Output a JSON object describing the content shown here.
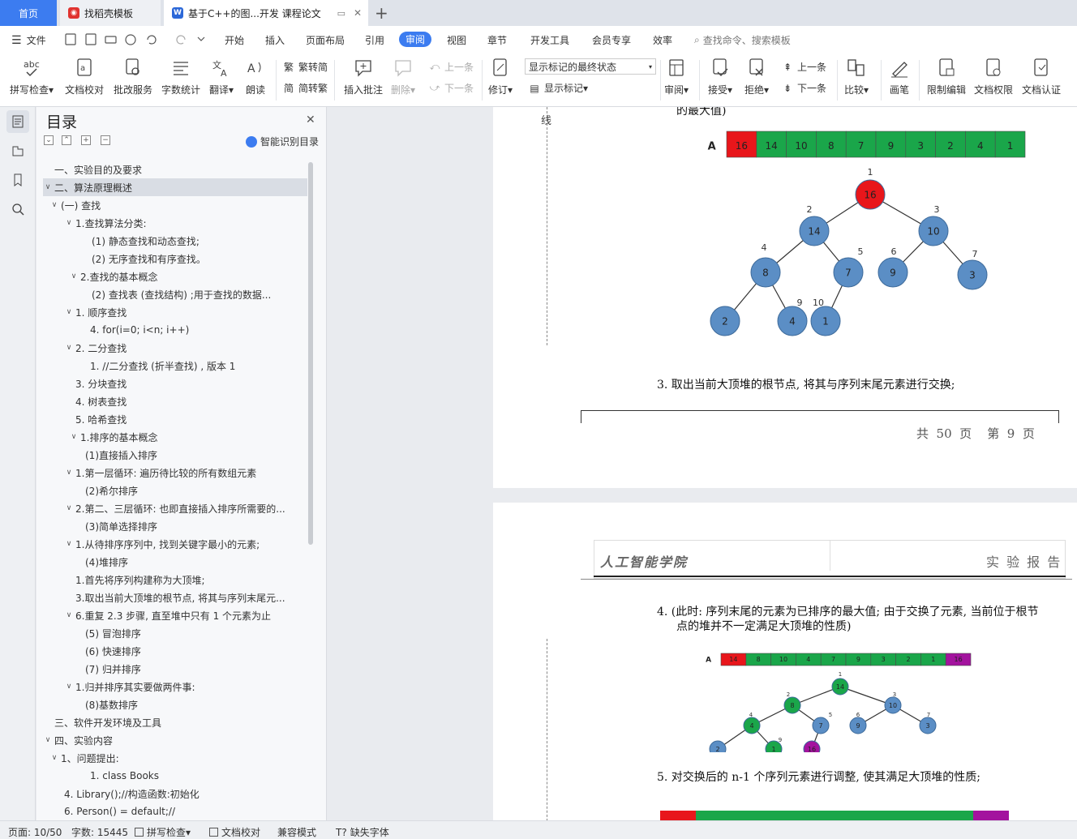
{
  "tabs": {
    "home": "首页",
    "template": "找稻壳模板",
    "doc": "基于C++的图...开发 课程论文"
  },
  "menu": {
    "file": "文件",
    "items": [
      "开始",
      "插入",
      "页面布局",
      "引用",
      "审阅",
      "视图",
      "章节",
      "开发工具",
      "会员专享",
      "效率"
    ],
    "active": "审阅",
    "search_placeholder": "查找命令、搜索模板"
  },
  "ribbon": {
    "spell": "拼写检查",
    "doc_check": "文档校对",
    "review_service": "批改服务",
    "word_count": "字数统计",
    "translate": "翻译",
    "read": "朗读",
    "to_traditional": "繁转简",
    "to_simplified": "简转繁",
    "insert_comment": "插入批注",
    "delete": "删除",
    "prev": "上一条",
    "next": "下一条",
    "track": "修订",
    "markup_state": "显示标记的最终状态",
    "show_markup": "显示标记",
    "review": "审阅",
    "accept": "接受",
    "reject": "拒绝",
    "prev2": "上一条",
    "next2": "下一条",
    "compare": "比较",
    "pen": "画笔",
    "restrict_edit": "限制编辑",
    "doc_permission": "文档权限",
    "doc_cert": "文档认证"
  },
  "toc": {
    "title": "目录",
    "smart": "智能识别目录",
    "items": [
      {
        "text": "一、实验目的及要求",
        "level": 1,
        "arrow": ""
      },
      {
        "text": "二、算法原理概述",
        "level": 1,
        "arrow": "down",
        "selected": true
      },
      {
        "text": "(一) 查找",
        "level": 2,
        "arrow": "down"
      },
      {
        "text": "1.查找算法分类:",
        "level": 3,
        "arrow": "down"
      },
      {
        "text": "(1) 静态查找和动态查找;",
        "level": 4,
        "arrow": ""
      },
      {
        "text": "(2) 无序查找和有序查找。",
        "level": 4,
        "arrow": ""
      },
      {
        "text": "2.查找的基本概念",
        "level": 3,
        "arrow": "down",
        "indent_extra": true
      },
      {
        "text": "(2) 查找表 (查找结构) ;用于查找的数据...",
        "level": 4,
        "arrow": ""
      },
      {
        "text": "1. 顺序查找",
        "level": 3,
        "arrow": "down"
      },
      {
        "text": "4.        for(i=0; i<n; i++)",
        "level": 4,
        "arrow": "",
        "tight": true
      },
      {
        "text": "2. 二分查找",
        "level": 3,
        "arrow": "down"
      },
      {
        "text": "1.    //二分查找 (折半查找) , 版本 1",
        "level": 4,
        "arrow": "",
        "tight": true
      },
      {
        "text": "3. 分块查找",
        "level": 3,
        "arrow": ""
      },
      {
        "text": "4. 树表查找",
        "level": 3,
        "arrow": ""
      },
      {
        "text": "5. 哈希查找",
        "level": 3,
        "arrow": ""
      },
      {
        "text": "1.排序的基本概念",
        "level": 3,
        "arrow": "down",
        "indent_extra": true
      },
      {
        "text": "(1)直接插入排序",
        "level": 4,
        "arrow": "",
        "mid": true
      },
      {
        "text": "1.第一层循环: 遍历待比较的所有数组元素",
        "level": 3,
        "arrow": "down"
      },
      {
        "text": "(2)希尔排序",
        "level": 4,
        "arrow": "",
        "mid": true
      },
      {
        "text": "2.第二、三层循环: 也即直接插入排序所需要的...",
        "level": 3,
        "arrow": "down"
      },
      {
        "text": "(3)简单选择排序",
        "level": 4,
        "arrow": "",
        "mid": true
      },
      {
        "text": "1.从待排序序列中, 找到关键字最小的元素;",
        "level": 3,
        "arrow": "down"
      },
      {
        "text": "(4)堆排序",
        "level": 4,
        "arrow": "",
        "mid": true
      },
      {
        "text": "1.首先将序列构建称为大顶堆;",
        "level": 3,
        "arrow": ""
      },
      {
        "text": "3.取出当前大顶堆的根节点, 将其与序列末尾元...",
        "level": 3,
        "arrow": ""
      },
      {
        "text": "6.重复 2.3 步骤, 直至堆中只有 1 个元素为止",
        "level": 3,
        "arrow": "down"
      },
      {
        "text": "(5) 冒泡排序",
        "level": 4,
        "arrow": "",
        "mid": true
      },
      {
        "text": "(6) 快速排序",
        "level": 4,
        "arrow": "",
        "mid": true
      },
      {
        "text": "(7) 归并排序",
        "level": 4,
        "arrow": "",
        "mid": true
      },
      {
        "text": "1.归并排序其实要做两件事:",
        "level": 3,
        "arrow": "down"
      },
      {
        "text": "(8)基数排序",
        "level": 4,
        "arrow": "",
        "mid": true
      },
      {
        "text": "三、软件开发环境及工具",
        "level": 1,
        "arrow": ""
      },
      {
        "text": "四、实验内容",
        "level": 1,
        "arrow": "down"
      },
      {
        "text": "1、问题提出:",
        "level": 2,
        "arrow": "down"
      },
      {
        "text": "1.     class Books",
        "level": 4,
        "arrow": "",
        "tight": true
      },
      {
        "text": "4.     Library();//构造函数:初始化",
        "level": 3,
        "arrow": "",
        "code": true
      },
      {
        "text": "6.     Person() = default;//",
        "level": 3,
        "arrow": "",
        "code": true
      }
    ]
  },
  "page1": {
    "top_text": "的最大值)",
    "margin_char": "线",
    "array_label": "A",
    "array": [
      "16",
      "14",
      "10",
      "8",
      "7",
      "9",
      "3",
      "2",
      "4",
      "1"
    ],
    "tree_nodes": [
      {
        "v": "16",
        "idx": "1",
        "color": "red"
      },
      {
        "v": "14",
        "idx": "2"
      },
      {
        "v": "10",
        "idx": "3"
      },
      {
        "v": "8",
        "idx": "4"
      },
      {
        "v": "7",
        "idx": "5"
      },
      {
        "v": "9",
        "idx": "6"
      },
      {
        "v": "3",
        "idx": "7"
      },
      {
        "v": "2",
        "idx": ""
      },
      {
        "v": "4",
        "idx": "9"
      },
      {
        "v": "1",
        "idx": "10"
      }
    ],
    "step3": "3.   取出当前大顶堆的根节点, 将其与序列末尾元素进行交换;",
    "footer": "共  50  页    第  9  页"
  },
  "page2": {
    "header_left": "人工智能学院",
    "header_right": "实 验 报 告",
    "step4_line1": "4.   (此时: 序列末尾的元素为已排序的最大值; 由于交换了元素, 当前位于根节",
    "step4_line2": "点的堆并不一定满足大顶堆的性质)",
    "array_label": "A",
    "array": [
      "14",
      "8",
      "10",
      "4",
      "7",
      "9",
      "3",
      "2",
      "1",
      "16"
    ],
    "tree_nodes": [
      {
        "v": "14",
        "idx": "1",
        "color": "green"
      },
      {
        "v": "8",
        "idx": "2",
        "color": "green"
      },
      {
        "v": "10",
        "idx": "3",
        "color": "blue"
      },
      {
        "v": "4",
        "idx": "4",
        "color": "green"
      },
      {
        "v": "7",
        "idx": "5",
        "color": "blue"
      },
      {
        "v": "9",
        "idx": "6",
        "color": "blue"
      },
      {
        "v": "3",
        "idx": "7",
        "color": "blue"
      },
      {
        "v": "2",
        "idx": "",
        "color": "blue"
      },
      {
        "v": "1",
        "idx": "9",
        "color": "green"
      },
      {
        "v": "16",
        "idx": "",
        "color": "purple"
      }
    ],
    "step5": "5.   对交换后的 n-1 个序列元素进行调整, 使其满足大顶堆的性质;"
  },
  "status": {
    "page": "页面: 10/50",
    "words": "字数: 15445",
    "spell": "拼写检查",
    "doc_check": "文档校对",
    "compat": "兼容模式",
    "missing_font": "缺失字体"
  },
  "colors": {
    "accent": "#3c7cf0",
    "red_node": "#e8161b",
    "blue_node": "#5b8ec5",
    "green_cell": "#1aa64a",
    "purple": "#a3139e"
  }
}
